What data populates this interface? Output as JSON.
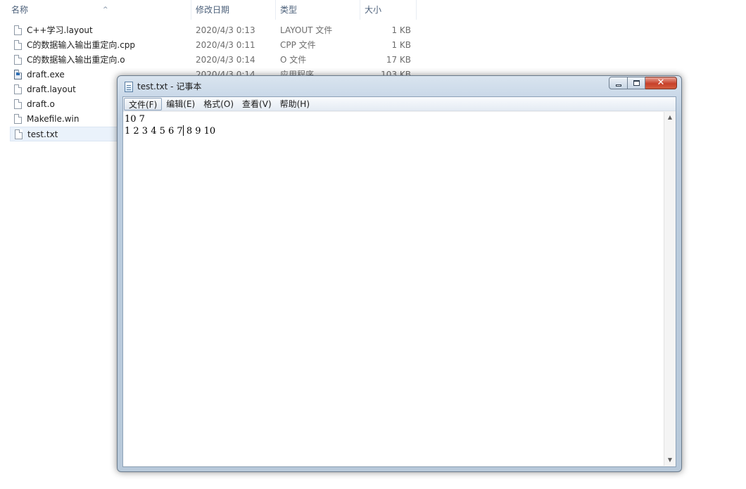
{
  "explorer": {
    "headers": {
      "name": "名称",
      "date": "修改日期",
      "type": "类型",
      "size": "大小"
    },
    "sort_arrow": "^",
    "files": [
      {
        "name": "C++学习.layout",
        "date": "2020/4/3 0:13",
        "type": "LAYOUT 文件",
        "size": "1 KB",
        "icon": "file-icon"
      },
      {
        "name": "C的数据输入输出重定向.cpp",
        "date": "2020/4/3 0:11",
        "type": "CPP 文件",
        "size": "1 KB",
        "icon": "file-icon"
      },
      {
        "name": "C的数据输入输出重定向.o",
        "date": "2020/4/3 0:14",
        "type": "O 文件",
        "size": "17 KB",
        "icon": "file-icon"
      },
      {
        "name": "draft.exe",
        "date": "2020/4/3 0:14",
        "type": "应用程序",
        "size": "103 KB",
        "icon": "exe-icon"
      },
      {
        "name": "draft.layout",
        "date": "",
        "type": "",
        "size": "",
        "icon": "file-icon"
      },
      {
        "name": "draft.o",
        "date": "",
        "type": "",
        "size": "",
        "icon": "file-icon"
      },
      {
        "name": "Makefile.win",
        "date": "",
        "type": "",
        "size": "",
        "icon": "file-icon"
      },
      {
        "name": "test.txt",
        "date": "",
        "type": "",
        "size": "",
        "icon": "text-file-icon",
        "selected": true
      }
    ]
  },
  "notepad": {
    "title": "test.txt - 记事本",
    "icon": "notepad-icon",
    "menu": [
      "文件(F)",
      "编辑(E)",
      "格式(O)",
      "查看(V)",
      "帮助(H)"
    ],
    "content_line1": "10 7",
    "content_line2_before_caret": "1 2 3 4 5 6 7",
    "content_line2_after_caret": " 8 9 10",
    "close_glyph": "✕"
  }
}
